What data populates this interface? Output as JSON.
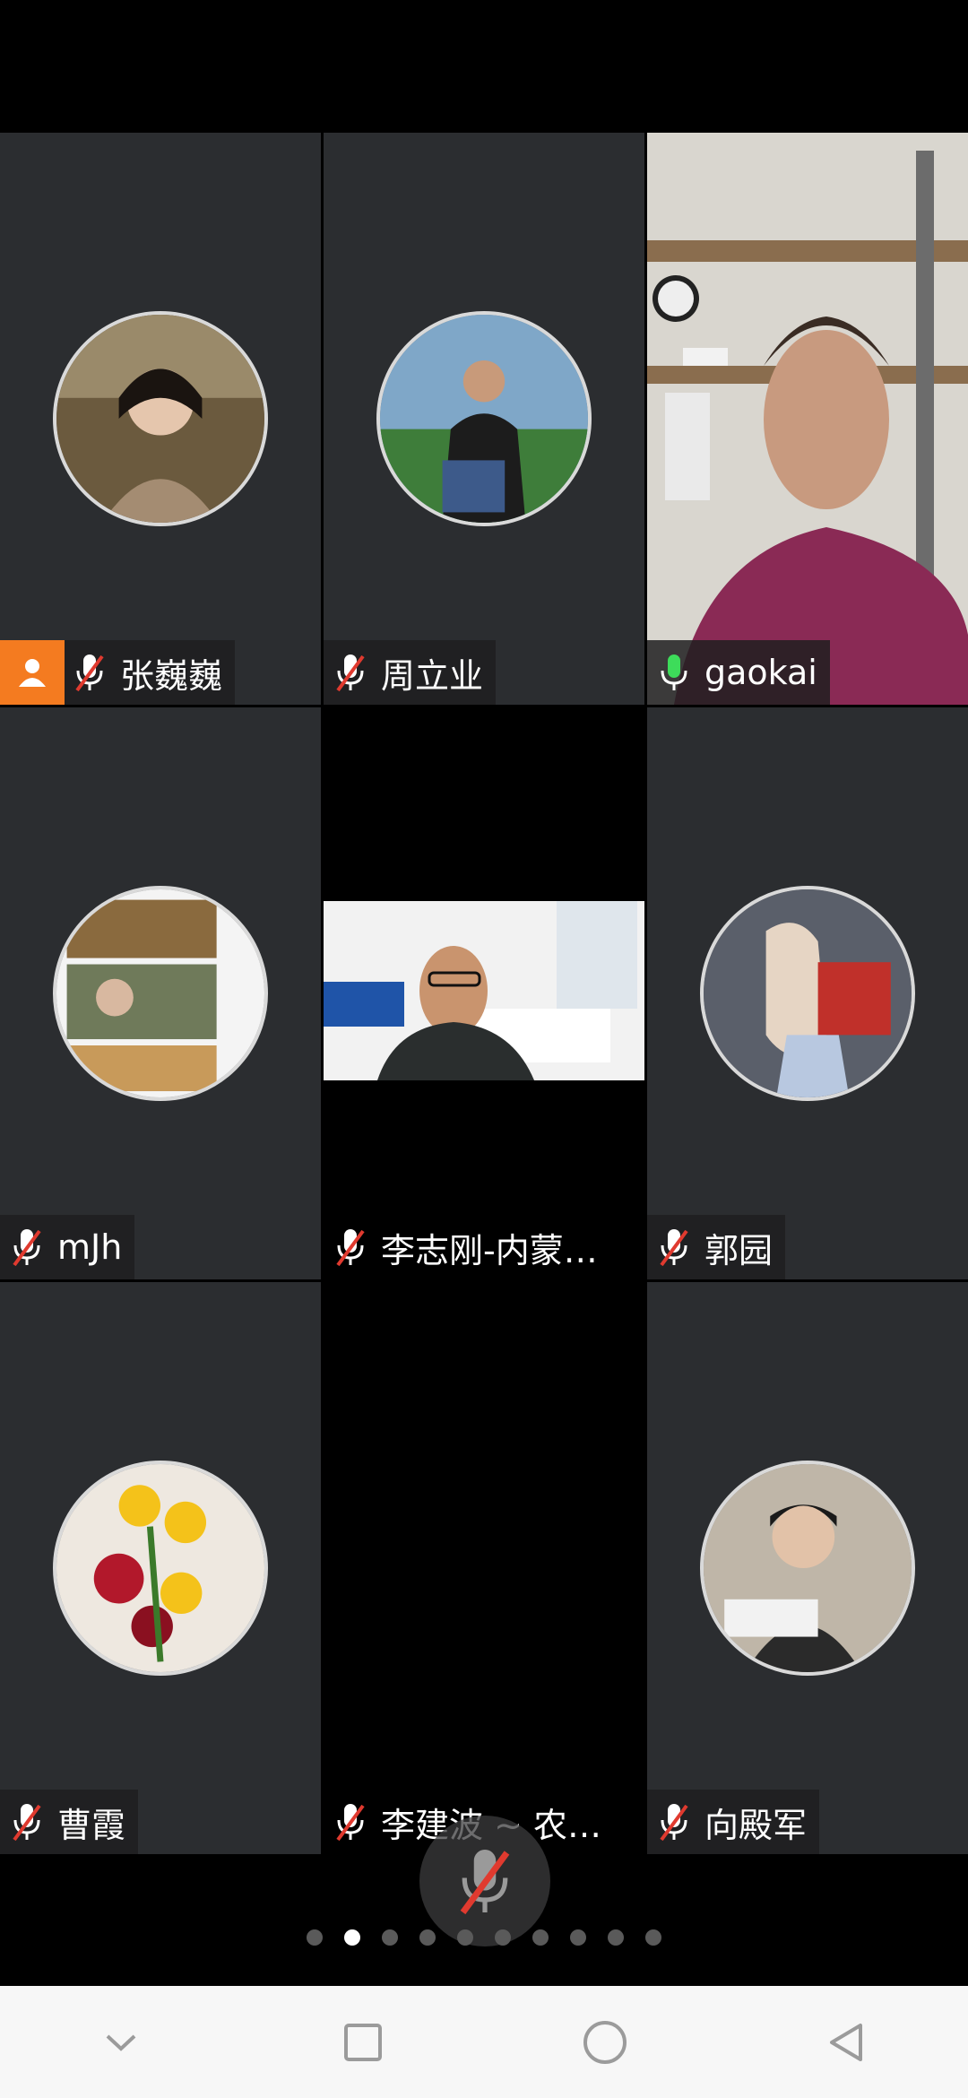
{
  "participants": [
    {
      "name": "张巍巍",
      "mic": "muted",
      "host": true
    },
    {
      "name": "周立业",
      "mic": "muted"
    },
    {
      "name": "gaokai",
      "mic": "active"
    },
    {
      "name": "mJh",
      "mic": "muted"
    },
    {
      "name": "李志刚-内蒙…",
      "mic": "muted"
    },
    {
      "name": "郭园",
      "mic": "muted"
    },
    {
      "name": "曹霞",
      "mic": "muted"
    },
    {
      "name": "李建波 ~ 农…",
      "mic": "muted"
    },
    {
      "name": "向殿军",
      "mic": "muted"
    }
  ],
  "pager": {
    "total": 10,
    "active_index": 1
  },
  "colors": {
    "tile_bg": "#2b2d30",
    "active_speaker_border": "#2fbf5b",
    "host_badge": "#f47b20",
    "muted_slash": "#e03a2f",
    "mic_active": "#3ddc5a"
  },
  "icons": {
    "muted": "mic-off-icon",
    "active": "mic-icon",
    "host": "person-icon",
    "center": "mic-off-icon"
  },
  "navbar": {
    "back": "chevron-down-icon",
    "recents": "square-icon",
    "home": "circle-icon",
    "back_triangle": "triangle-back-icon"
  }
}
